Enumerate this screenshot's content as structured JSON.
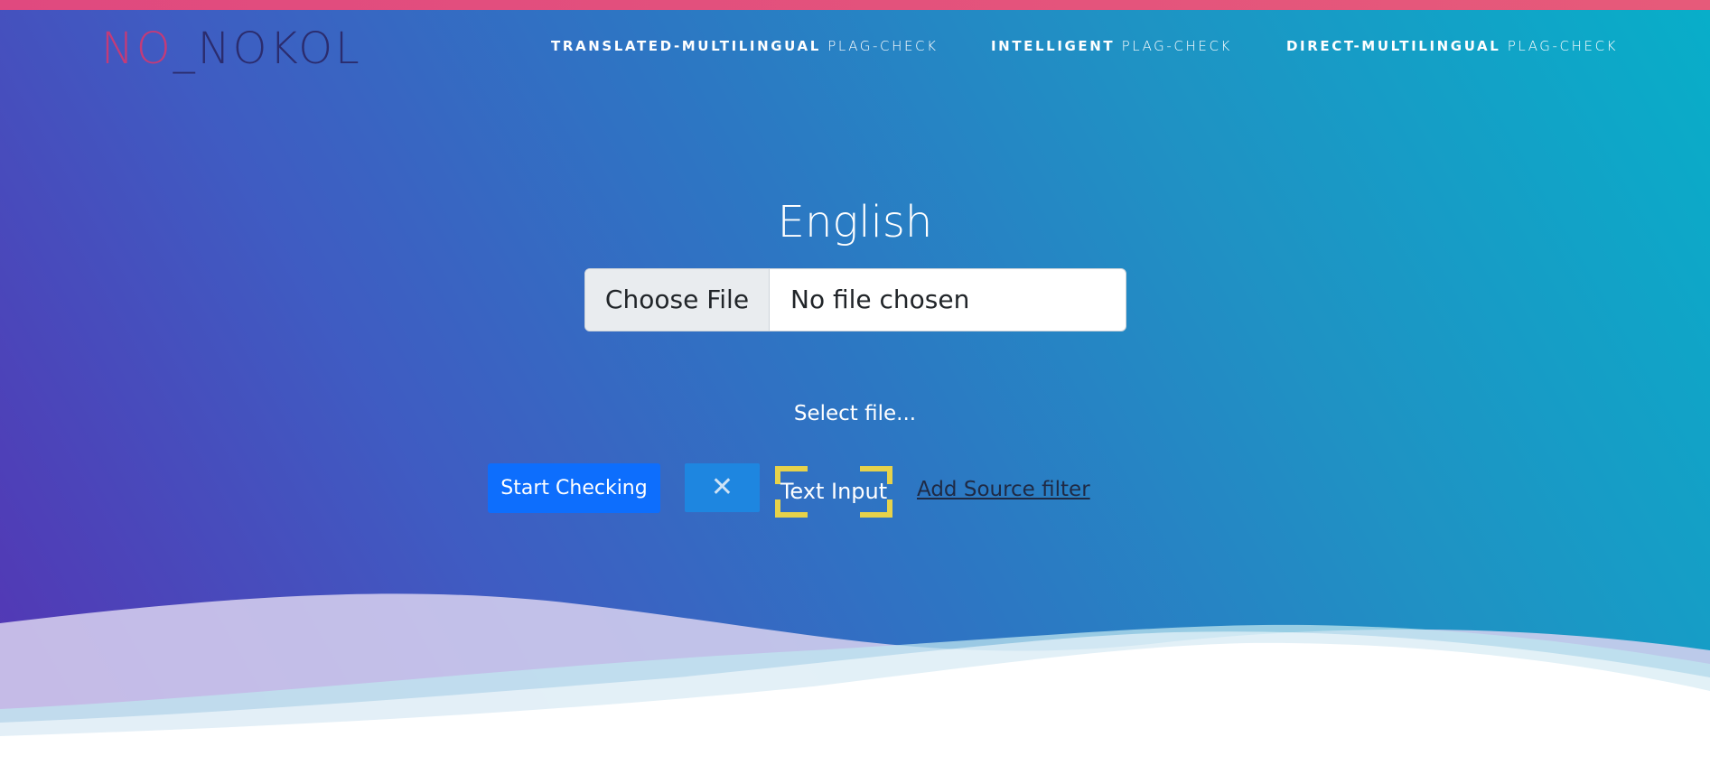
{
  "brand": {
    "part1": "NO",
    "part2": "_NOKOL",
    "accent_color": "#c43b78",
    "dark_color": "#2b2c6e"
  },
  "nav": [
    {
      "bold": "TRANSLATED-MULTILINGUAL",
      "light": "PLAG-CHECK"
    },
    {
      "bold": "INTELLIGENT",
      "light": "PLAG-CHECK"
    },
    {
      "bold": "DIRECT-MULTILINGUAL",
      "light": "PLAG-CHECK"
    }
  ],
  "main": {
    "language": "English",
    "file_input": {
      "button_label": "Choose File",
      "status": "No file chosen"
    },
    "select_label": "Select file...",
    "actions": {
      "start_label": "Start Checking",
      "clear_icon": "close-icon",
      "text_input_label": "Text Input",
      "add_source_label": "Add Source filter"
    }
  },
  "colors": {
    "top_stripe": "#e0497f",
    "gradient_start": "#5533b3",
    "gradient_end": "#08aec9",
    "primary_button": "#0d6efd",
    "highlight_corners": "#e6d24a"
  }
}
